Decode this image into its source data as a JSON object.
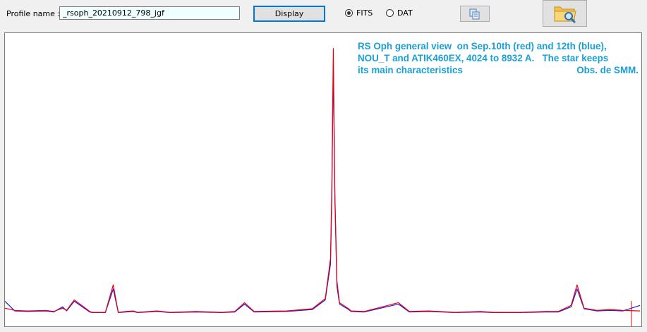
{
  "toolbar": {
    "profile_label": "Profile name :",
    "profile_value": "_rsoph_20210912_798_jgf",
    "display_label": "Display",
    "format_options": [
      {
        "label": "FITS",
        "selected": true
      },
      {
        "label": "DAT",
        "selected": false
      }
    ],
    "copy_icon": "copy-icon",
    "open_icon": "folder-search-icon"
  },
  "annotation": {
    "line1": "RS Oph general view  on Sep.10th (red) and 12th (blue),",
    "line2": "NOU_T and ATIK460EX, 4024 to 8932 A.   The star keeps",
    "line3_left": "its main characteristics",
    "line3_right": "Obs. de SMM."
  },
  "colors": {
    "series_red": "#e8000f",
    "series_blue": "#1d1dd8",
    "annotation_text": "#1a9fd6",
    "input_background": "#f0ffff"
  },
  "chart_data": {
    "type": "line",
    "x_range": [
      4024,
      8932
    ],
    "ylim": [
      0,
      1
    ],
    "grid": false,
    "series": [
      {
        "name": "Sep.10th (red)",
        "color": "#e8000f",
        "x": [
          4024,
          4100,
          4200,
          4340,
          4400,
          4470,
          4500,
          4560,
          4680,
          4700,
          4800,
          4861,
          4900,
          4960,
          5015,
          5050,
          5200,
          5300,
          5500,
          5700,
          5800,
          5876,
          5950,
          6200,
          6400,
          6500,
          6540,
          6550,
          6562,
          6574,
          6590,
          6610,
          6680,
          6700,
          6800,
          7065,
          7150,
          7300,
          7500,
          7700,
          7800,
          8000,
          8200,
          8300,
          8400,
          8446,
          8500,
          8600,
          8700,
          8800,
          8932
        ],
        "y": [
          0.02,
          0.012,
          0.01,
          0.012,
          0.008,
          0.02,
          0.012,
          0.05,
          0.008,
          0.005,
          0.005,
          0.105,
          0.005,
          0.008,
          0.01,
          0.005,
          0.01,
          0.005,
          0.008,
          0.005,
          0.008,
          0.04,
          0.008,
          0.01,
          0.018,
          0.055,
          0.2,
          0.44,
          0.965,
          0.44,
          0.12,
          0.04,
          0.018,
          0.01,
          0.008,
          0.04,
          0.008,
          0.01,
          0.005,
          0.008,
          0.005,
          0.005,
          0.008,
          0.008,
          0.03,
          0.105,
          0.02,
          0.012,
          0.015,
          0.012,
          0.01
        ]
      },
      {
        "name": "Sep.12th (blue)",
        "color": "#1d1dd8",
        "x": [
          4024,
          4100,
          4200,
          4340,
          4400,
          4470,
          4500,
          4560,
          4680,
          4700,
          4800,
          4861,
          4900,
          4960,
          5015,
          5050,
          5200,
          5300,
          5500,
          5700,
          5800,
          5876,
          5950,
          6200,
          6400,
          6500,
          6540,
          6550,
          6562,
          6574,
          6590,
          6610,
          6680,
          6700,
          6800,
          7065,
          7150,
          7300,
          7500,
          7700,
          7800,
          8000,
          8200,
          8300,
          8400,
          8446,
          8500,
          8600,
          8700,
          8800,
          8932
        ],
        "y": [
          0.045,
          0.01,
          0.008,
          0.01,
          0.006,
          0.025,
          0.01,
          0.045,
          0.006,
          0.004,
          0.004,
          0.09,
          0.004,
          0.006,
          0.008,
          0.004,
          0.008,
          0.004,
          0.006,
          0.004,
          0.006,
          0.035,
          0.006,
          0.008,
          0.015,
          0.05,
          0.18,
          0.4,
          0.91,
          0.42,
          0.1,
          0.035,
          0.015,
          0.008,
          0.006,
          0.035,
          0.006,
          0.008,
          0.004,
          0.006,
          0.004,
          0.004,
          0.006,
          0.006,
          0.025,
          0.09,
          0.018,
          0.01,
          0.012,
          0.01,
          0.03
        ]
      }
    ]
  }
}
